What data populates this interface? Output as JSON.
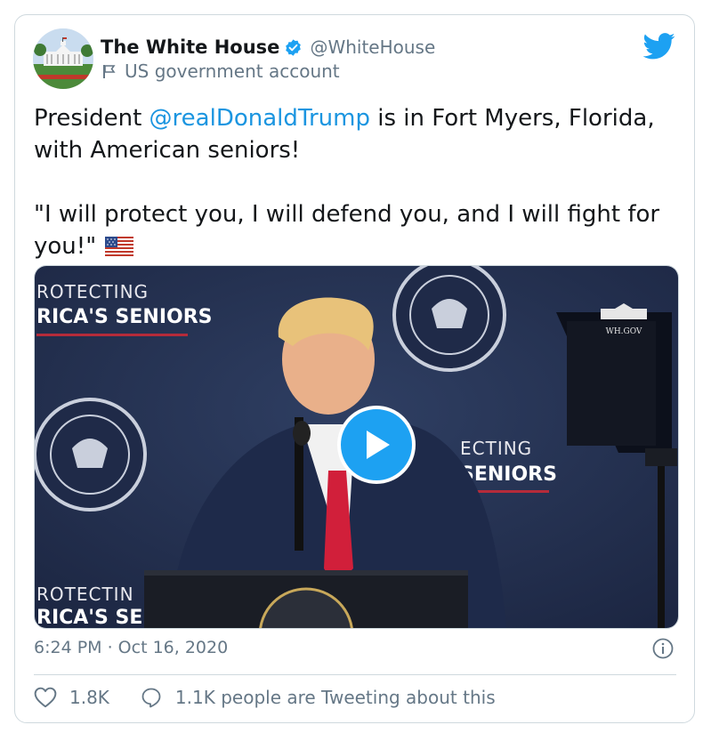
{
  "account": {
    "name": "The White House",
    "handle": "@WhiteHouse",
    "label": "US government account"
  },
  "tweet": {
    "text_prefix": "President ",
    "mention": "@realDonaldTrump",
    "text_suffix": " is in Fort Myers, Florida, with American seniors!",
    "quote": "\"I will protect you, I will defend you, and I will fight for you!\""
  },
  "media": {
    "banner_top_line1": "ROTECTING",
    "banner_top_line2": "RICA'S SENIORS",
    "banner_mid_line1": "ECTING",
    "banner_mid_line2": "SENIORS",
    "banner_bottom_line1": "ROTECTIN",
    "banner_bottom_line2": "RICA'S SEI",
    "wh_gov": "WH.GOV"
  },
  "meta": {
    "timestamp": "6:24 PM · Oct 16, 2020"
  },
  "actions": {
    "likes": "1.8K",
    "conversation": "1.1K people are Tweeting about this"
  },
  "colors": {
    "accent": "#1da1f2",
    "link": "#1b95e0",
    "secondary_text": "#657786",
    "border": "#cfd9de"
  }
}
